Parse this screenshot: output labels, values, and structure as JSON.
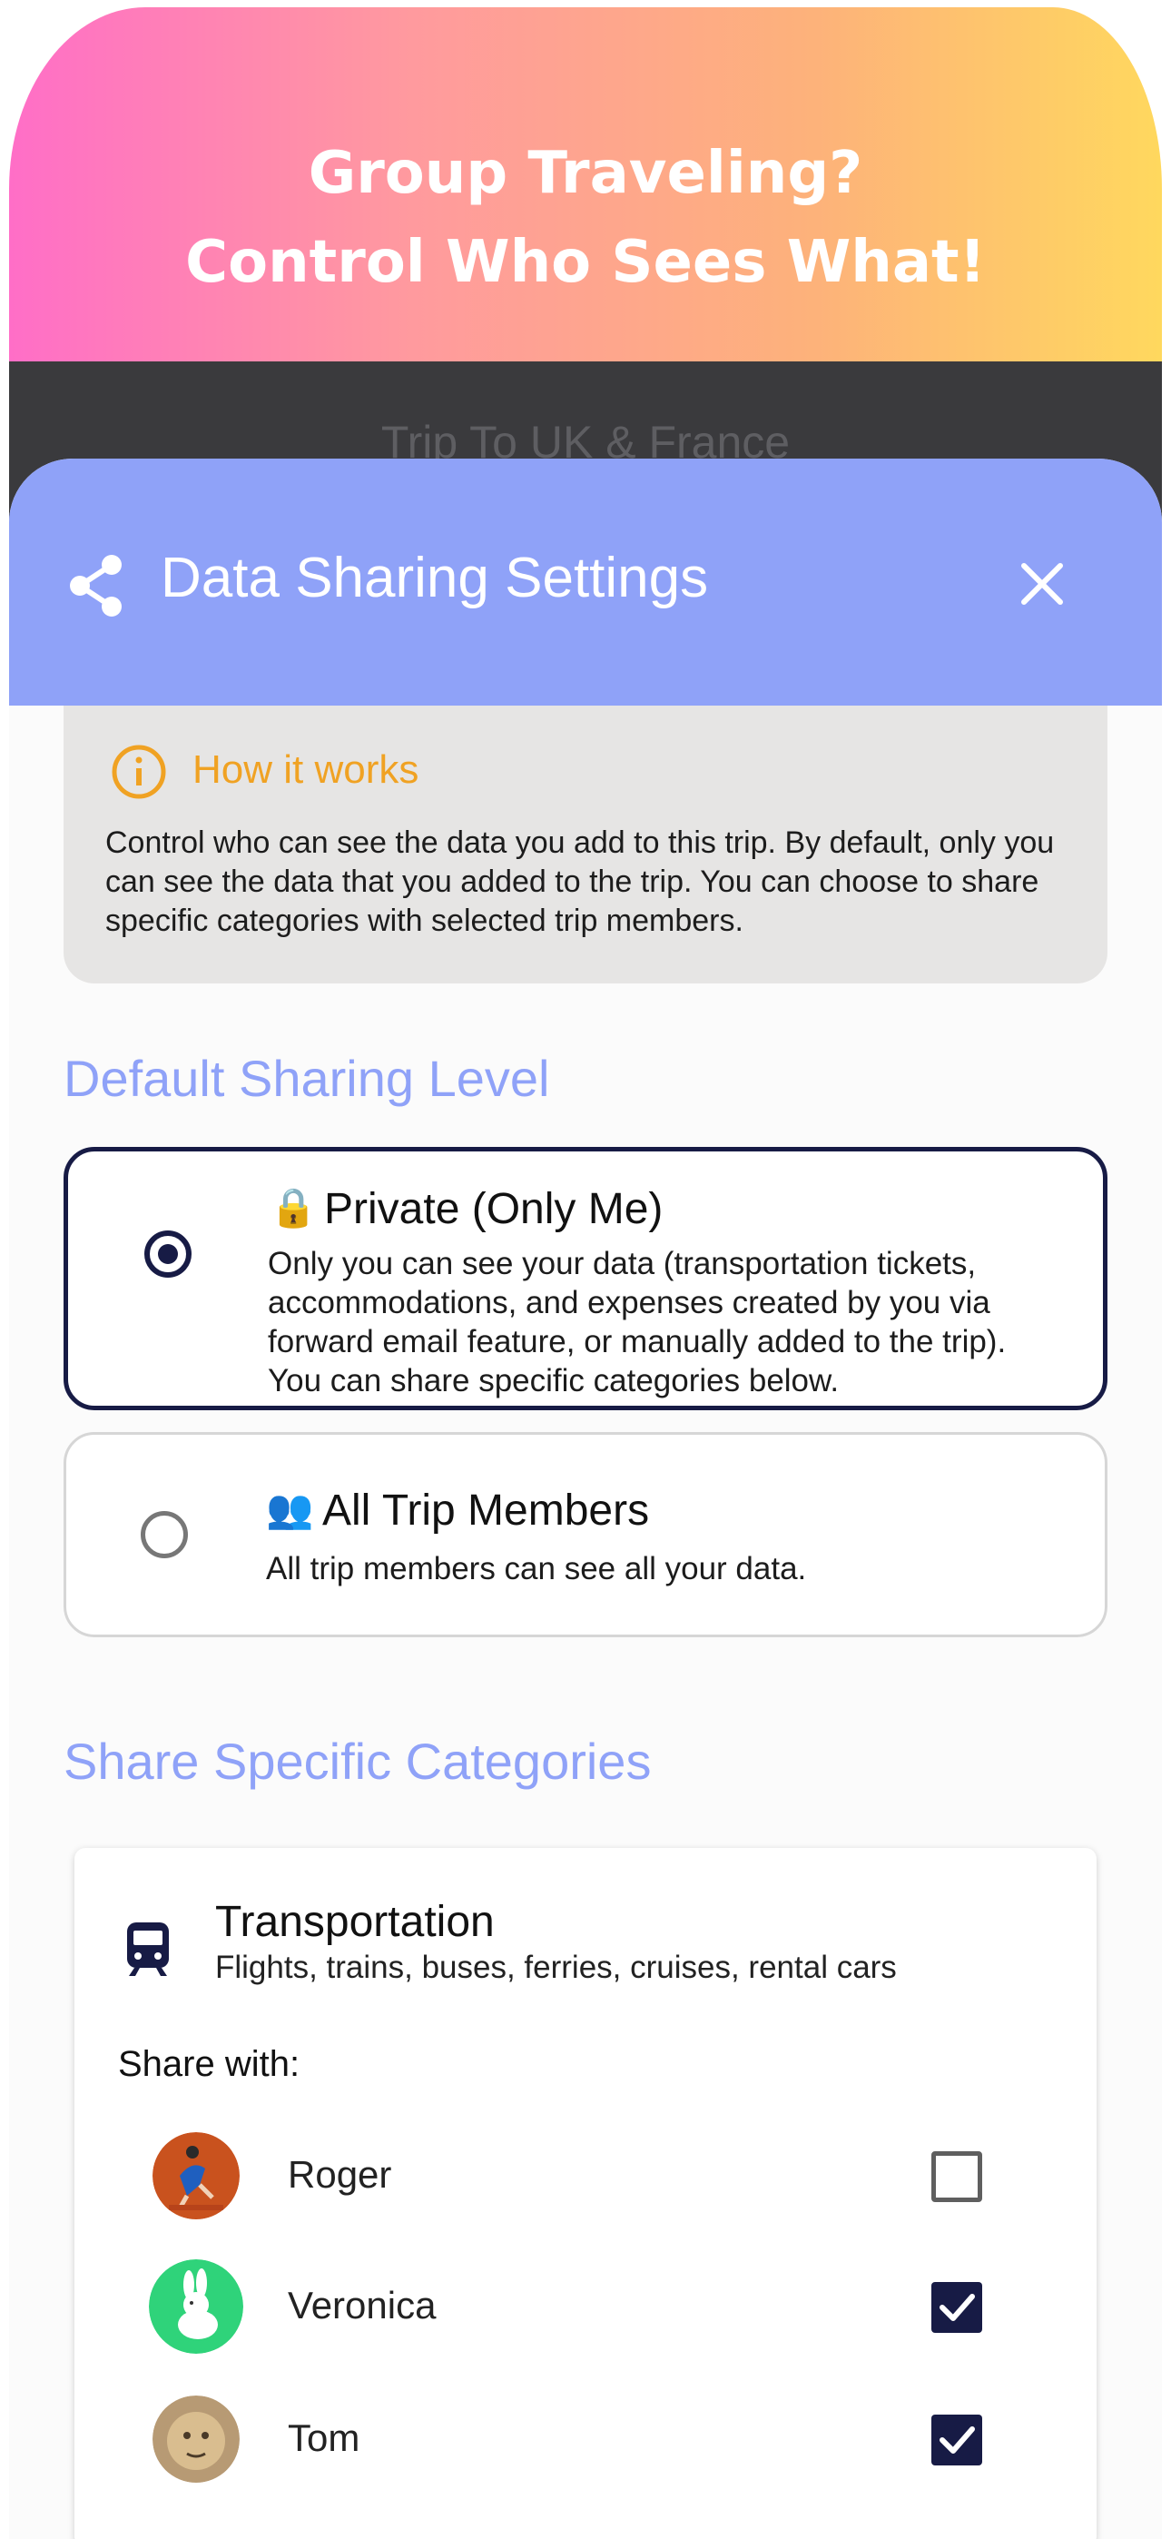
{
  "promo": {
    "line1": "Group Traveling?",
    "line2": "Control Who Sees What!"
  },
  "trip": {
    "title": "Trip To UK & France"
  },
  "sheet": {
    "title": "Data Sharing Settings",
    "share_icon": "share-icon",
    "close_icon": "close-icon"
  },
  "info": {
    "icon": "info-icon",
    "title": "How it works",
    "text": "Control who can see the data you add to this trip. By default, only you can see the data that you added to the trip. You can choose to share specific categories with selected trip members."
  },
  "default_sharing": {
    "heading": "Default Sharing Level",
    "options": [
      {
        "icon": "🔒",
        "title": "Private (Only Me)",
        "description": "Only you can see your data (transportation tickets, accommodations, and expenses created by you via forward email feature, or manually added to the trip). You can share specific categories below.",
        "selected": true
      },
      {
        "icon": "👥",
        "title": "All Trip Members",
        "description": "All trip members can see all your data.",
        "selected": false
      }
    ]
  },
  "categories": {
    "heading": "Share Specific Categories",
    "items": [
      {
        "icon": "bus-icon",
        "title": "Transportation",
        "description": "Flights, trains, buses, ferries, cruises, rental cars",
        "share_label": "Share with:",
        "members": [
          {
            "name": "Roger",
            "checked": false
          },
          {
            "name": "Veronica",
            "checked": true
          },
          {
            "name": "Tom",
            "checked": true
          }
        ]
      }
    ]
  },
  "colors": {
    "accent": "#8fa2f8",
    "navy": "#171b45",
    "warning": "#f0a223",
    "info_bg": "#e6e5e4"
  }
}
